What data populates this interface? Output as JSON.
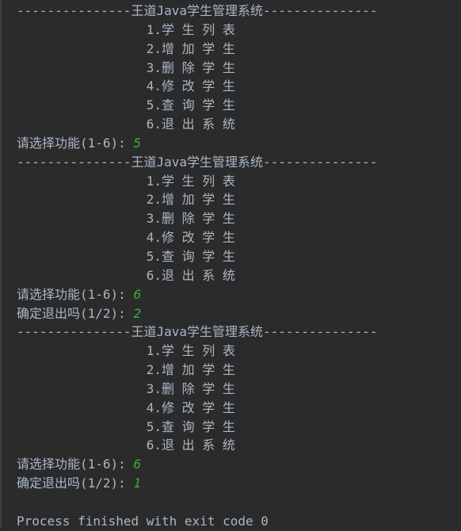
{
  "console": {
    "lines": [
      {
        "text": "---------------王道Java学生管理系统---------------"
      },
      {
        "text": "                 1.学 生 列 表"
      },
      {
        "text": "                 2.增 加 学 生"
      },
      {
        "text": "                 3.删 除 学 生"
      },
      {
        "text": "                 4.修 改 学 生"
      },
      {
        "text": "                 5.查 询 学 生"
      },
      {
        "text": "                 6.退 出 系 统"
      },
      {
        "text": "请选择功能(1-6): ",
        "input": "5"
      },
      {
        "text": "---------------王道Java学生管理系统---------------"
      },
      {
        "text": "                 1.学 生 列 表"
      },
      {
        "text": "                 2.增 加 学 生"
      },
      {
        "text": "                 3.删 除 学 生"
      },
      {
        "text": "                 4.修 改 学 生"
      },
      {
        "text": "                 5.查 询 学 生"
      },
      {
        "text": "                 6.退 出 系 统"
      },
      {
        "text": "请选择功能(1-6): ",
        "input": "6"
      },
      {
        "text": "确定退出吗(1/2): ",
        "input": "2"
      },
      {
        "text": "---------------王道Java学生管理系统---------------"
      },
      {
        "text": "                 1.学 生 列 表"
      },
      {
        "text": "                 2.增 加 学 生"
      },
      {
        "text": "                 3.删 除 学 生"
      },
      {
        "text": "                 4.修 改 学 生"
      },
      {
        "text": "                 5.查 询 学 生"
      },
      {
        "text": "                 6.退 出 系 统"
      },
      {
        "text": "请选择功能(1-6): ",
        "input": "6"
      },
      {
        "text": "确定退出吗(1/2): ",
        "input": "1"
      },
      {
        "text": ""
      },
      {
        "text": "Process finished with exit code 0"
      }
    ]
  },
  "colors": {
    "background": "#2b2b2b",
    "output_text": "#a9b7c6",
    "user_input": "#3cae3c"
  }
}
